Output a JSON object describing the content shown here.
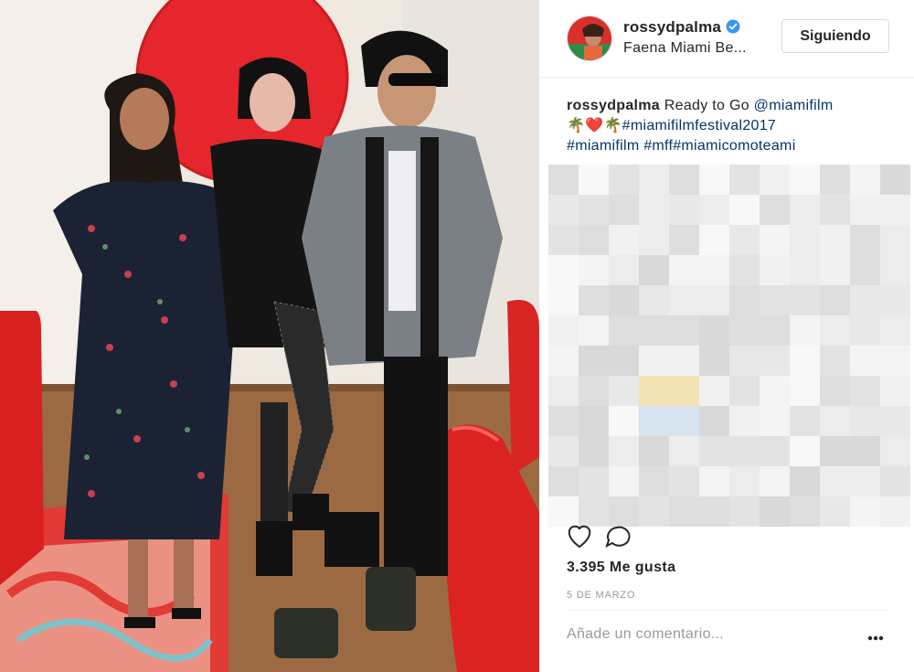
{
  "post": {
    "username": "rossydpalma",
    "verified_icon": "verified-badge-icon",
    "location": "Faena Miami Be...",
    "follow_label": "Siguiendo"
  },
  "caption": {
    "username": "rossydpalma",
    "text_before": "Ready to Go",
    "mention": "@miamifilm",
    "emojis": "🌴❤️🌴",
    "hashtag_1": "#miamifilmfestival2017",
    "hashtag_2": "#miamifilm",
    "hashtag_3": "#mff#miamicomoteami"
  },
  "actions": {
    "like_icon": "heart-icon",
    "comment_icon": "comment-icon"
  },
  "likes": "3.395 Me gusta",
  "date": "5 DE MARZO",
  "comment_bar": {
    "placeholder": "Añade un comentario...",
    "more_icon": "more-options-icon"
  },
  "colors": {
    "link": "#003569",
    "verified": "#3897f0",
    "border": "#dbdbdb",
    "muted": "#999999"
  }
}
